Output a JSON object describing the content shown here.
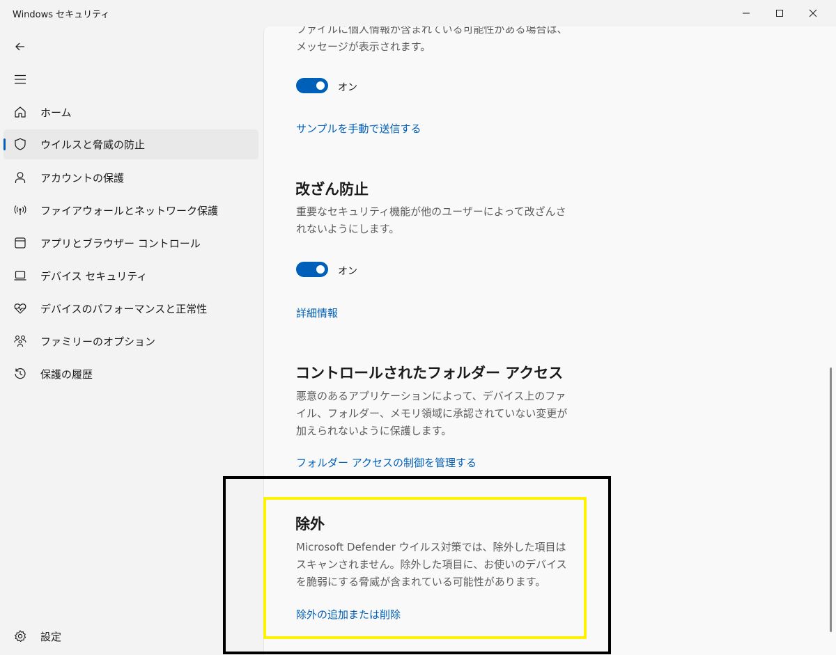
{
  "window": {
    "title": "Windows セキュリティ"
  },
  "sidebar": {
    "items": [
      {
        "label": "ホーム",
        "icon": "home-icon"
      },
      {
        "label": "ウイルスと脅威の防止",
        "icon": "shield-icon",
        "selected": true
      },
      {
        "label": "アカウントの保護",
        "icon": "person-icon"
      },
      {
        "label": "ファイアウォールとネットワーク保護",
        "icon": "antenna-icon"
      },
      {
        "label": "アプリとブラウザー コントロール",
        "icon": "app-window-icon"
      },
      {
        "label": "デバイス セキュリティ",
        "icon": "laptop-icon"
      },
      {
        "label": "デバイスのパフォーマンスと正常性",
        "icon": "heart-pulse-icon"
      },
      {
        "label": "ファミリーのオプション",
        "icon": "family-icon"
      },
      {
        "label": "保護の履歴",
        "icon": "history-icon"
      }
    ],
    "settings_label": "設定"
  },
  "content": {
    "top_para": "ファイルに個人情報が含まれている可能性がある場合は、メッセージが表示されます。",
    "sample_toggle": {
      "state": "オン",
      "on": true
    },
    "sample_link": "サンプルを手動で送信する",
    "tamper": {
      "title": "改ざん防止",
      "desc": "重要なセキュリティ機能が他のユーザーによって改ざんされないようにします。",
      "toggle": {
        "state": "オン",
        "on": true
      },
      "link": "詳細情報"
    },
    "cfa": {
      "title": "コントロールされたフォルダー アクセス",
      "desc": "悪意のあるアプリケーションによって、デバイス上のファイル、フォルダー、メモリ領域に承認されていない変更が加えられないように保護します。",
      "link": "フォルダー アクセスの制御を管理する"
    },
    "exclusions": {
      "title": "除外",
      "desc": "Microsoft Defender ウイルス対策では、除外した項目はスキャンされません。除外した項目に、お使いのデバイスを脆弱にする脅威が含まれている可能性があります。",
      "link": "除外の追加または削除"
    }
  },
  "colors": {
    "accent": "#005fb8",
    "annotation_outer": "#000000",
    "annotation_inner": "#fff200"
  }
}
